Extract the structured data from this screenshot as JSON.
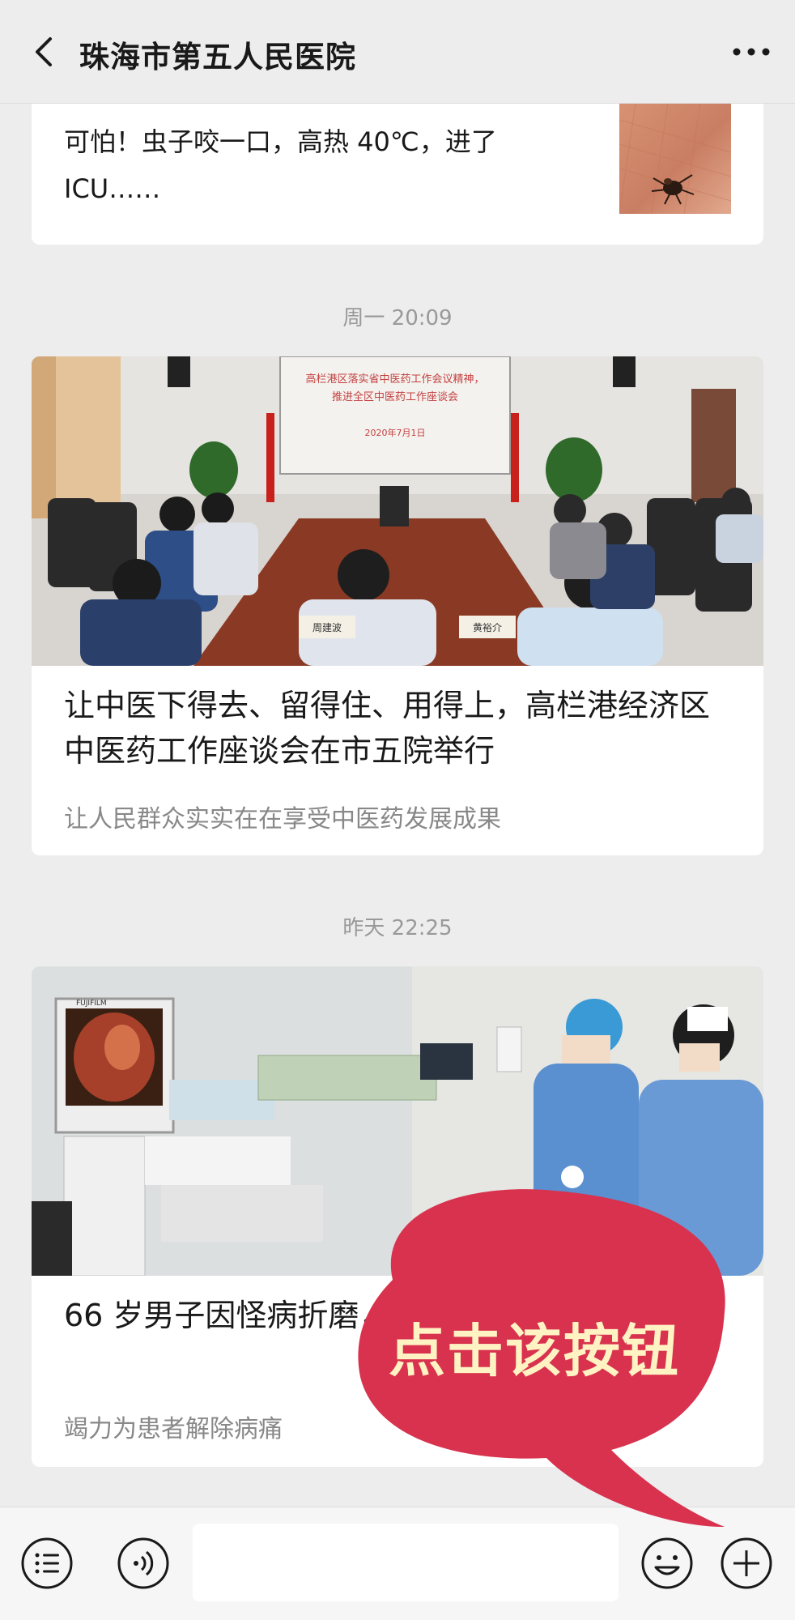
{
  "header": {
    "title": "珠海市第五人民医院",
    "back_icon": "chevron-left-icon",
    "more_icon": "more-horizontal-icon"
  },
  "feed": {
    "small_card": {
      "title": "可怕！虫子咬一口，高热 40℃，进了 ICU……"
    },
    "messages": [
      {
        "time": "周一 20:09",
        "slide_line1": "高栏港区落实省中医药工作会议精神，",
        "slide_line2": "推进全区中医药工作座谈会",
        "slide_date": "2020年7月1日",
        "name_card_1": "周建波",
        "name_card_2": "黄裕介",
        "title": "让中医下得去、留得住、用得上，高栏港经济区中医药工作座谈会在市五院举行",
        "subtitle": "让人民群众实实在在享受中医药发展成果"
      },
      {
        "time": "昨天 22:25",
        "device_brand": "FUJIFILM",
        "title": "66 岁男子因怪病折磨，用支气管镜让真凶现形",
        "subtitle": "竭力为患者解除病痛"
      }
    ]
  },
  "bottom_bar": {
    "menu_icon": "list-menu-icon",
    "voice_icon": "voice-icon",
    "emoji_icon": "emoji-icon",
    "plus_icon": "plus-icon"
  },
  "overlay": {
    "text": "点击该按钮",
    "color": "#d8324e"
  }
}
